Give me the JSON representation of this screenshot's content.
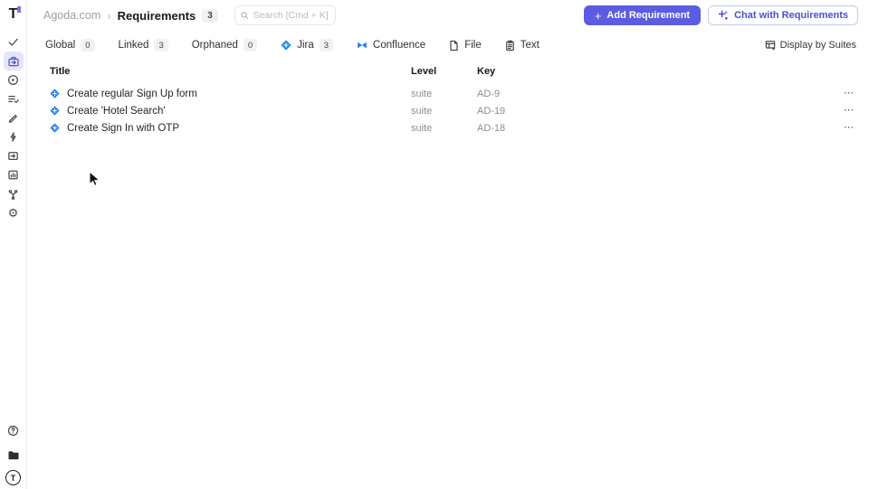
{
  "app_logo": {
    "letter": "T"
  },
  "sidebar": {
    "items": [
      "check-icon",
      "requirements-briefcase-icon",
      "run-history-icon",
      "checklist-icon",
      "pencil-icon",
      "bolt-icon",
      "import-icon",
      "report-chart-icon",
      "branch-icon",
      "settings-gear-icon"
    ],
    "active_item": "requirements-briefcase-icon",
    "bottom": [
      "help-icon",
      "folder-icon",
      "user-avatar"
    ],
    "avatar_letter": "T"
  },
  "header": {
    "breadcrumb": {
      "parent": "Agoda.com",
      "separator": "›",
      "current": "Requirements",
      "count": "3"
    },
    "search": {
      "placeholder": "Search [Cmd + K]"
    },
    "add_button": {
      "plus": "+",
      "label": "Add Requirement"
    },
    "chat_button": {
      "label": "Chat with Requirements"
    }
  },
  "filters": {
    "items": [
      {
        "label": "Global",
        "count": "0"
      },
      {
        "label": "Linked",
        "count": "3"
      },
      {
        "label": "Orphaned",
        "count": "0"
      },
      {
        "label": "Jira",
        "count": "3",
        "icon": "jira-icon"
      },
      {
        "label": "Confluence",
        "icon": "confluence-icon"
      },
      {
        "label": "File",
        "icon": "file-icon"
      },
      {
        "label": "Text",
        "icon": "clipboard-icon"
      }
    ],
    "display_toggle": {
      "label": "Display by Suites",
      "icon": "table-layout-icon"
    }
  },
  "table": {
    "columns": {
      "title": "Title",
      "level": "Level",
      "key": "Key"
    },
    "rows": [
      {
        "icon": "jira-icon",
        "title": "Create regular Sign Up form",
        "level": "suite",
        "key": "AD-9",
        "menu": "⋯"
      },
      {
        "icon": "jira-icon",
        "title": "Create 'Hotel Search'",
        "level": "suite",
        "key": "AD-19",
        "menu": "⋯"
      },
      {
        "icon": "jira-icon",
        "title": "Create Sign In with OTP",
        "level": "suite",
        "key": "AD-18",
        "menu": "⋯"
      }
    ]
  },
  "colors": {
    "accent": "#5b5ce2",
    "jira_blue": "#2186eb",
    "badge_bg": "#f1f1f3",
    "active_nav_bg": "#e4e4fa"
  },
  "icons_glyphs": {
    "ellipsis": "⋯",
    "gear": "⚙",
    "question": "?"
  }
}
